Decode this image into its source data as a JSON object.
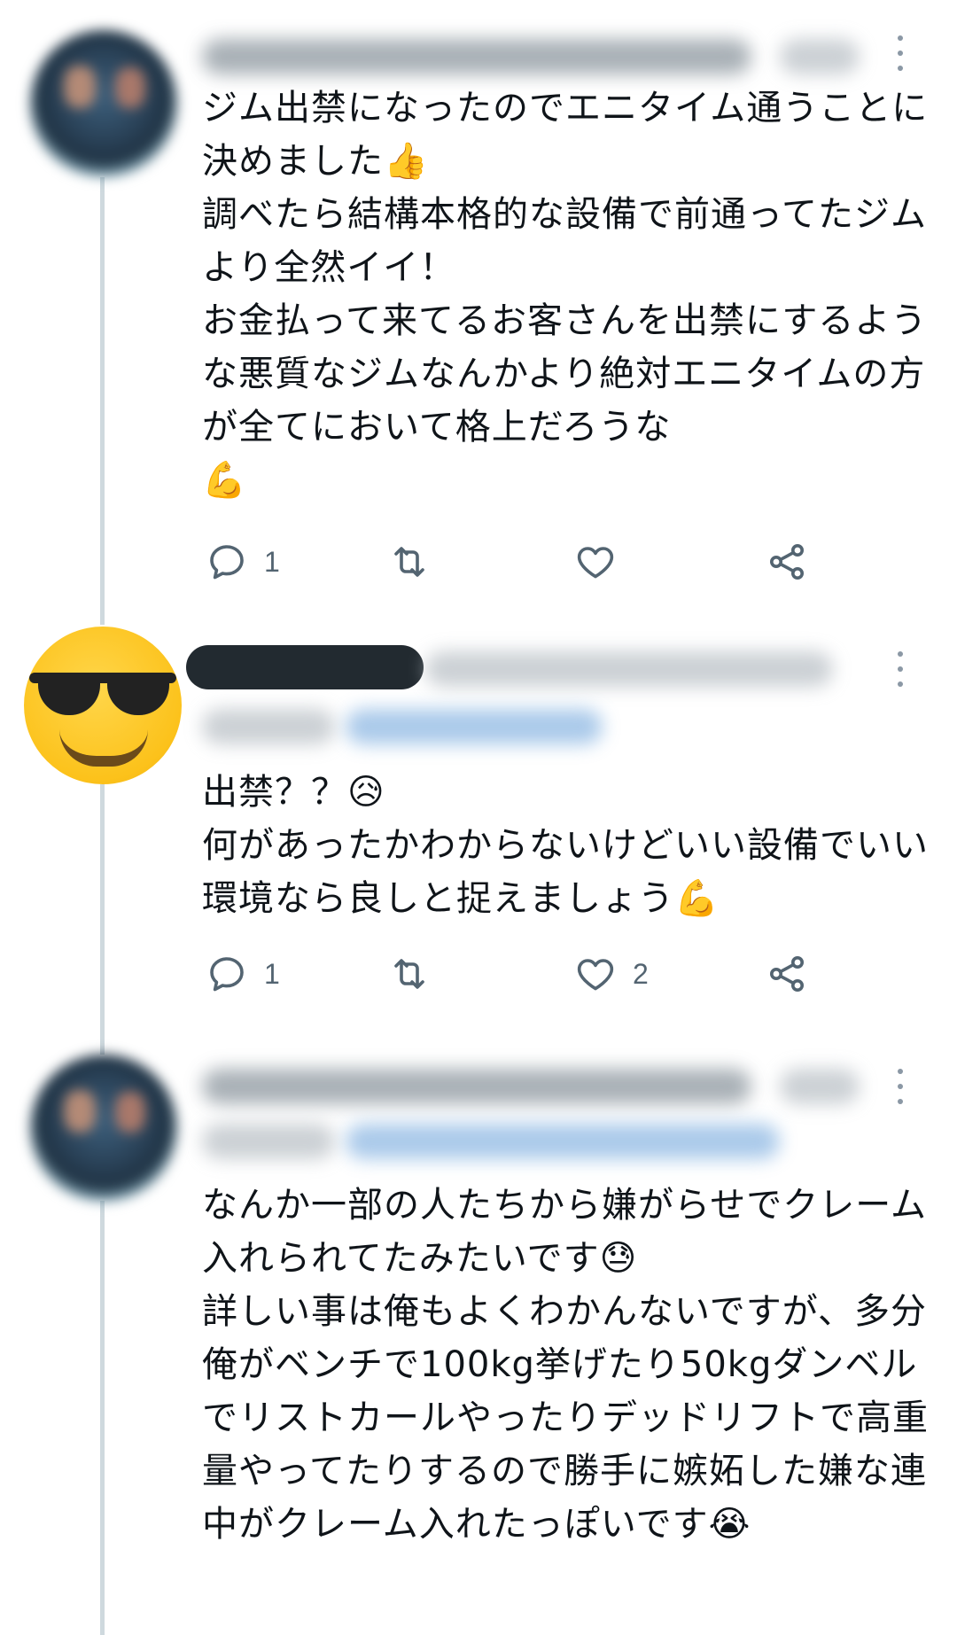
{
  "tweets": [
    {
      "author_hidden": true,
      "text": "ジム出禁になったのでエニタイム通うことに決めました👍\n調べたら結構本格的な設備で前通ってたジムより全然イイ！\nお金払って来てるお客さんを出禁にするような悪質なジムなんかより絶対エニタイムの方が全てにおいて格上だろうな\n💪",
      "reply_count": "1",
      "retweet_count": "",
      "like_count": ""
    },
    {
      "author_hidden": true,
      "text": "出禁？？😥\n何があったかわからないけどいい設備でいい環境なら良しと捉えましょう💪",
      "reply_count": "1",
      "retweet_count": "",
      "like_count": "2"
    },
    {
      "author_hidden": true,
      "text": "なんか一部の人たちから嫌がらせでクレーム入れられてたみたいです😓\n詳しい事は俺もよくわかんないですが、多分俺がベンチで100kg挙げたり50kgダンベルでリストカールやったりデッドリフトで高重量やってたりするので勝手に嫉妬した嫌な連中がクレーム入れたっぽいです😭"
    }
  ],
  "icons": {
    "reply": "reply-icon",
    "retweet": "retweet-icon",
    "like": "heart-icon",
    "share": "share-icon",
    "more": "more-icon"
  },
  "colors": {
    "text": "#0f1419",
    "muted": "#536471",
    "thread_line": "#cfd9de"
  }
}
